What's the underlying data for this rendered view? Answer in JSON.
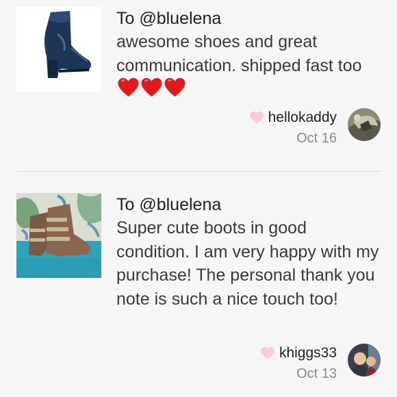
{
  "reviews": [
    {
      "to": "To @bluelena",
      "comment": "awesome shoes and great communication. shipped fast too",
      "emoji_hearts": 3,
      "username": "hellokaddy",
      "date": "Oct 16",
      "thumb_icon": "velvet-ankle-boot-image",
      "avatar_icon": "user-avatar-hellokaddy"
    },
    {
      "to": "To @bluelena",
      "comment": "Super cute boots in good condition. I am very happy with my purchase! The personal thank you note is such a nice touch too!",
      "username": "khiggs33",
      "date": "Oct 13",
      "thumb_icon": "buckle-ankle-boots-image",
      "avatar_icon": "user-avatar-khiggs33"
    }
  ],
  "colors": {
    "background": "#f6f6f6",
    "heart_pink": "#f7cdd3",
    "emoji_heart_red": "#e0191c",
    "date_gray": "#8a8a8a"
  }
}
